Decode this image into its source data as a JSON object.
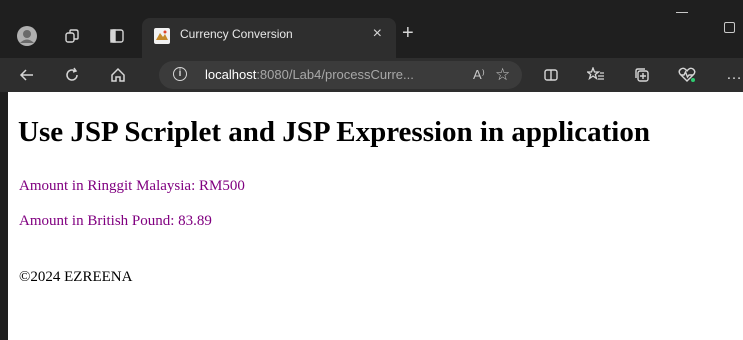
{
  "browser": {
    "tab": {
      "title": "Currency Conversion",
      "close_label": "×"
    },
    "new_tab_label": "+",
    "address": {
      "host": "localhost",
      "rest": ":8080/Lab4/processCurre...",
      "read_aloud_label": "A⁾"
    }
  },
  "page": {
    "heading": "Use JSP Scriplet and JSP Expression in application",
    "myr_line": "Amount in Ringgit Malaysia: RM500",
    "gbp_line": "Amount in British Pound: 83.89",
    "footer": "©2024 EZREENA"
  },
  "colors": {
    "amount_text": "#800080",
    "browser_chrome": "#1f1f1f",
    "toolbar": "#2e2e2e"
  },
  "icons": [
    "profile-icon",
    "workspaces-icon",
    "tab-actions-icon",
    "favicon",
    "close-icon",
    "new-tab-icon",
    "back-icon",
    "refresh-icon",
    "home-icon",
    "info-icon",
    "read-aloud-icon",
    "favorite-star-icon",
    "split-screen-icon",
    "favorites-icon",
    "collections-icon",
    "health-icon",
    "more-icon",
    "minimize-icon",
    "maximize-icon"
  ]
}
